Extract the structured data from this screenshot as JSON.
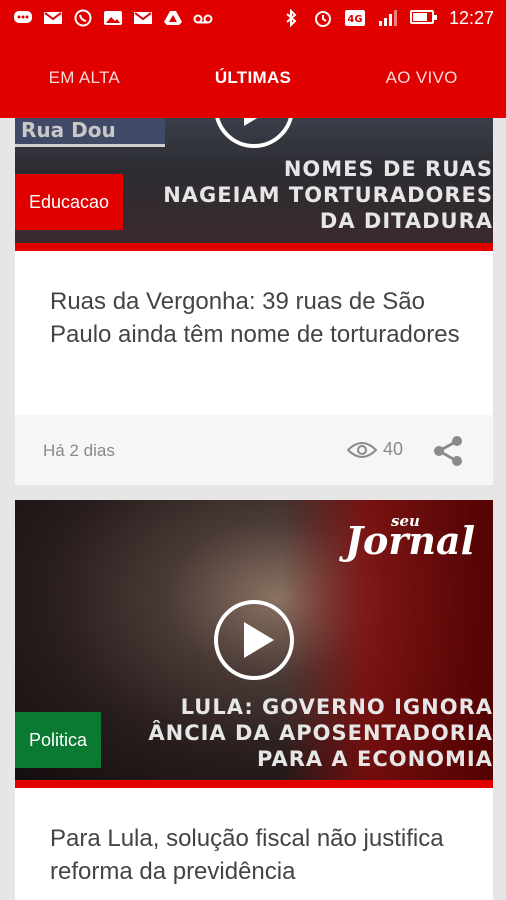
{
  "status_bar": {
    "time": "12:27",
    "network": "4G",
    "battery_level": 0.8,
    "icons": [
      "chat-icon",
      "gmail-icon",
      "whatsapp-icon",
      "image-icon",
      "gmail-icon",
      "drive-icon",
      "voicemail-icon",
      "bluetooth-icon",
      "alarm-icon",
      "4g-icon",
      "signal-icon",
      "battery-icon"
    ]
  },
  "tabs": [
    {
      "label": "EM ALTA",
      "active": false
    },
    {
      "label": "ÚLTIMAS",
      "active": true
    },
    {
      "label": "AO VIVO",
      "active": false
    }
  ],
  "articles": [
    {
      "category": "Educacao",
      "category_color": "#e00000",
      "image_text": [
        "NOMES DE RUAS",
        "NAGEIAM TORTURADORES",
        "DA DITADURA"
      ],
      "image_sign_text": "Rua Dou",
      "title": "Ruas da Vergonha: 39 ruas de São Paulo ainda têm nome de torturadores",
      "time_ago": "Há 2 dias",
      "views": "40"
    },
    {
      "category": "Politica",
      "category_color": "#0a7a32",
      "logo_top": "seu",
      "logo_main": "Jornal",
      "image_text": [
        "LULA: GOVERNO IGNORA",
        "ÂNCIA DA APOSENTADORIA",
        "PARA A ECONOMIA"
      ],
      "title": "Para Lula, solução fiscal não justifica reforma da previdência"
    }
  ],
  "colors": {
    "brand": "#e00000",
    "politica": "#0a7a32"
  }
}
